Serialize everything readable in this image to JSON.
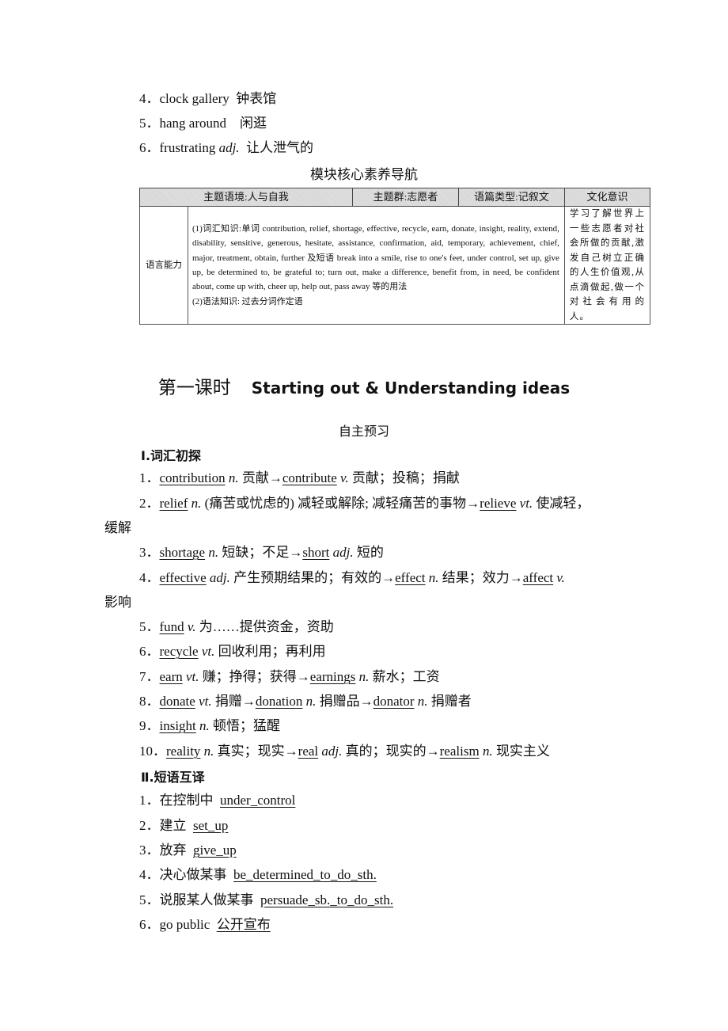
{
  "intro_list": [
    {
      "num": "4．",
      "en": "clock gallery",
      "pos": "",
      "cn": "钟表馆"
    },
    {
      "num": "5．",
      "en": "hang around",
      "pos": "",
      "cn": "闲逛"
    },
    {
      "num": "6．",
      "en": "frustrating",
      "pos": "adj.",
      "cn": "让人泄气的"
    }
  ],
  "table_caption": "模块核心素养导航",
  "core_table": {
    "headers": [
      "主题语境:人与自我",
      "主题群:志愿者",
      "语篇类型:记叙文",
      "文化意识"
    ],
    "row_label": "语言能力",
    "language_text_1": "(1)词汇知识:单词 contribution, relief, shortage, effective, recycle, earn, donate, insight, reality, extend, disability, sensitive, generous, hesitate, assistance, confirmation, aid, temporary, achievement, chief, major, treatment, obtain, further 及短语 break into a smile, rise to one's feet, under control, set up, give up, be determined to, be grateful to; turn out, make a difference, benefit from, in need, be confident about, come up with, cheer up, help out, pass away 等的用法",
    "language_text_2": "(2)语法知识: 过去分词作定语",
    "culture_text": "学习了解世界上一些志愿者对社会所做的贡献,激发自己树立正确的人生价值观,从点滴做起,做一个对社会有用的人。"
  },
  "lesson": {
    "title_cn": "第一课时",
    "title_en": "Starting out & Understanding ideas",
    "subtitle": "自主预习"
  },
  "section1": {
    "title": "Ⅰ.词汇初探",
    "items": [
      {
        "num": "1．",
        "parts": [
          [
            "u",
            "contribution"
          ],
          [
            "i",
            " n."
          ],
          [
            "t",
            "  贡献→"
          ],
          [
            "u",
            "contribute"
          ],
          [
            "i",
            " v."
          ],
          [
            "t",
            "  贡献；投稿；捐献"
          ]
        ]
      },
      {
        "num": "2．",
        "parts": [
          [
            "u",
            "relief"
          ],
          [
            "i",
            " n."
          ],
          [
            "t",
            " (痛苦或忧虑的)  减轻或解除; 减轻痛苦的事物→"
          ],
          [
            "u",
            "relieve"
          ],
          [
            "i",
            " vt."
          ],
          [
            "t",
            "  使减轻，"
          ]
        ],
        "cont": "缓解"
      },
      {
        "num": "3．",
        "parts": [
          [
            "u",
            "shortage"
          ],
          [
            "i",
            " n."
          ],
          [
            "t",
            "  短缺；不足→"
          ],
          [
            "u",
            "short"
          ],
          [
            "i",
            " adj."
          ],
          [
            "t",
            "  短的"
          ]
        ]
      },
      {
        "num": "4．",
        "parts": [
          [
            "u",
            "effective"
          ],
          [
            "i",
            " adj."
          ],
          [
            "t",
            "  产生预期结果的；有效的→"
          ],
          [
            "u",
            "effect"
          ],
          [
            "i",
            " n."
          ],
          [
            "t",
            "  结果；效力→"
          ],
          [
            "u",
            "affect"
          ],
          [
            "i",
            " v."
          ]
        ],
        "cont": "影响"
      },
      {
        "num": "5．",
        "parts": [
          [
            "u",
            "fund"
          ],
          [
            "i",
            " v."
          ],
          [
            "t",
            "  为……提供资金，资助"
          ]
        ]
      },
      {
        "num": "6．",
        "parts": [
          [
            "u",
            "recycle"
          ],
          [
            "i",
            " vt."
          ],
          [
            "t",
            "  回收利用；再利用"
          ]
        ]
      },
      {
        "num": "7．",
        "parts": [
          [
            "u",
            "earn"
          ],
          [
            "i",
            " vt."
          ],
          [
            "t",
            "  赚；挣得；获得→"
          ],
          [
            "u",
            "earnings"
          ],
          [
            "i",
            " n."
          ],
          [
            "t",
            "  薪水；工资"
          ]
        ]
      },
      {
        "num": "8．",
        "parts": [
          [
            "u",
            "donate"
          ],
          [
            "i",
            " vt."
          ],
          [
            "t",
            "  捐赠→"
          ],
          [
            "u",
            "donation"
          ],
          [
            "i",
            " n."
          ],
          [
            "t",
            "  捐赠品→"
          ],
          [
            "u",
            "donator"
          ],
          [
            "i",
            " n."
          ],
          [
            "t",
            "  捐赠者"
          ]
        ]
      },
      {
        "num": "9．",
        "parts": [
          [
            "u",
            "insight"
          ],
          [
            "i",
            " n."
          ],
          [
            "t",
            "  顿悟；猛醒"
          ]
        ]
      },
      {
        "num": "10．",
        "parts": [
          [
            "u",
            "reality"
          ],
          [
            "i",
            " n."
          ],
          [
            "t",
            "  真实；现实→"
          ],
          [
            "u",
            "real"
          ],
          [
            "i",
            " adj."
          ],
          [
            "t",
            "  真的；现实的→"
          ],
          [
            "u",
            "realism"
          ],
          [
            "i",
            " n."
          ],
          [
            "t",
            "  现实主义"
          ]
        ]
      }
    ]
  },
  "section2": {
    "title": "Ⅱ.短语互译",
    "items": [
      {
        "num": "1．",
        "prompt": "在控制中",
        "answer": "under_control"
      },
      {
        "num": "2．",
        "prompt": "建立",
        "answer": "set_up"
      },
      {
        "num": "3．",
        "prompt": "放弃",
        "answer": "give_up"
      },
      {
        "num": "4．",
        "prompt": "决心做某事",
        "answer": "be_determined_to_do_sth."
      },
      {
        "num": "5．",
        "prompt": "说服某人做某事",
        "answer": "persuade_sb._to_do_sth."
      },
      {
        "num": "6．",
        "prompt": "go public",
        "answer": "公开宣布"
      }
    ]
  }
}
